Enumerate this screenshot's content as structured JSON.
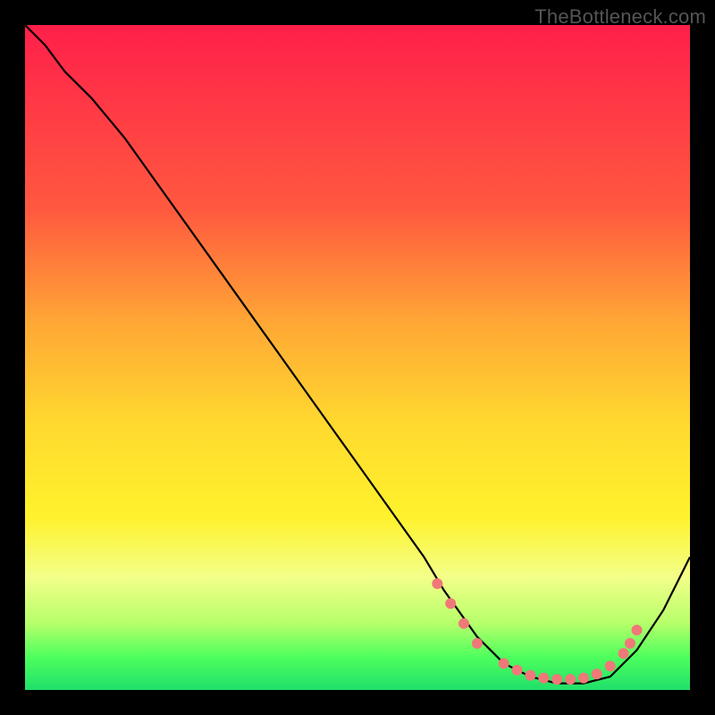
{
  "watermark": "TheBottleneck.com",
  "chart_data": {
    "type": "line",
    "title": "",
    "xlabel": "",
    "ylabel": "",
    "xlim": [
      0,
      100
    ],
    "ylim": [
      0,
      100
    ],
    "series": [
      {
        "name": "curve",
        "x": [
          0,
          3,
          6,
          10,
          15,
          20,
          25,
          30,
          35,
          40,
          45,
          50,
          55,
          60,
          63,
          68,
          72,
          76,
          80,
          84,
          88,
          92,
          96,
          100
        ],
        "y": [
          100,
          97,
          93,
          89,
          83,
          76,
          69,
          62,
          55,
          48,
          41,
          34,
          27,
          20,
          15,
          8,
          4,
          2,
          1,
          1,
          2,
          6,
          12,
          20
        ]
      }
    ],
    "markers": {
      "name": "dots",
      "x": [
        62,
        64,
        66,
        68,
        72,
        74,
        76,
        78,
        80,
        82,
        84,
        86,
        88,
        90,
        91,
        92
      ],
      "y": [
        16,
        13,
        10,
        7,
        4,
        3,
        2.2,
        1.8,
        1.6,
        1.6,
        1.8,
        2.4,
        3.6,
        5.5,
        7.0,
        9.0
      ]
    },
    "gradient_stops": [
      {
        "pos": 0,
        "color": "#ff1f4a"
      },
      {
        "pos": 28,
        "color": "#ff5a3f"
      },
      {
        "pos": 45,
        "color": "#ffa835"
      },
      {
        "pos": 60,
        "color": "#ffd92f"
      },
      {
        "pos": 74,
        "color": "#fff22c"
      },
      {
        "pos": 83,
        "color": "#f3ff89"
      },
      {
        "pos": 90,
        "color": "#b6ff6a"
      },
      {
        "pos": 95,
        "color": "#4eff5d"
      },
      {
        "pos": 100,
        "color": "#1fe06a"
      }
    ],
    "marker_color": "#f07878",
    "line_color": "#000000"
  }
}
